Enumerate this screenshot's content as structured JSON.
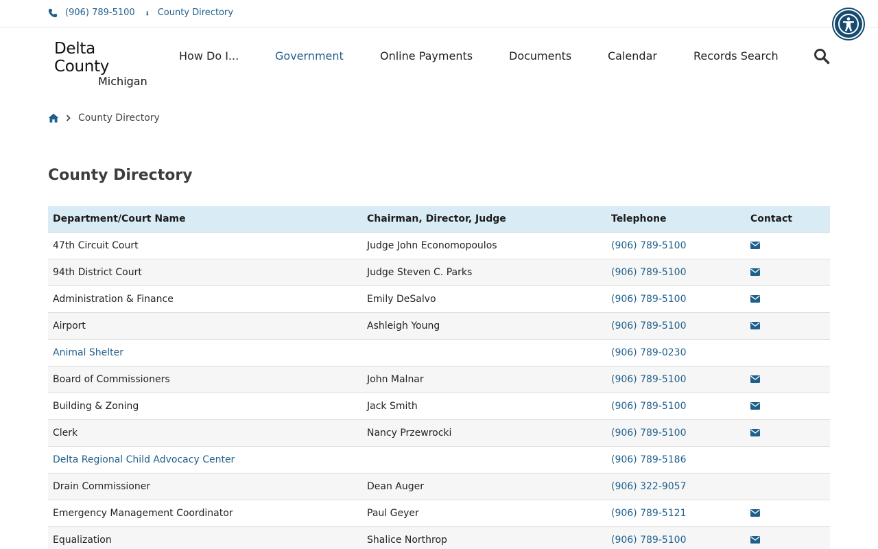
{
  "topbar": {
    "phone": "(906) 789-5100",
    "directory_link": "County Directory"
  },
  "logo": {
    "line1": "Delta County",
    "line2": "Michigan"
  },
  "nav": {
    "items": [
      {
        "label": "How Do I..."
      },
      {
        "label": "Government"
      },
      {
        "label": "Online Payments"
      },
      {
        "label": "Documents"
      },
      {
        "label": "Calendar"
      },
      {
        "label": "Records Search"
      }
    ]
  },
  "breadcrumb": {
    "current": "County Directory"
  },
  "page": {
    "title": "County Directory"
  },
  "table": {
    "headers": [
      "Department/Court Name",
      "Chairman, Director, Judge",
      "Telephone",
      "Contact"
    ],
    "rows": [
      {
        "name": "47th Circuit Court",
        "contact_person": "Judge John Economopoulos",
        "phone": "(906) 789-5100"
      },
      {
        "name": "94th District Court",
        "contact_person": "Judge Steven C. Parks",
        "phone": "(906) 789-5100"
      },
      {
        "name": "Administration & Finance",
        "contact_person": "Emily DeSalvo",
        "phone": "(906) 789-5100"
      },
      {
        "name": "Airport",
        "contact_person": "Ashleigh Young",
        "phone": "(906) 789-5100"
      },
      {
        "name": "Animal Shelter",
        "contact_person": "",
        "phone": "(906) 789-0230"
      },
      {
        "name": "Board of Commissioners",
        "contact_person": "John Malnar",
        "phone": "(906) 789-5100"
      },
      {
        "name": "Building & Zoning",
        "contact_person": "Jack Smith",
        "phone": "(906) 789-5100"
      },
      {
        "name": "Clerk",
        "contact_person": "Nancy Przewrocki",
        "phone": "(906) 789-5100"
      },
      {
        "name": "Delta Regional Child Advocacy Center",
        "contact_person": "",
        "phone": "(906) 789-5186"
      },
      {
        "name": "Drain Commissioner",
        "contact_person": "Dean Auger",
        "phone": "(906) 322-9057"
      },
      {
        "name": "Emergency Management Coordinator",
        "contact_person": "Paul Geyer",
        "phone": "(906) 789-5121"
      },
      {
        "name": "Equalization",
        "contact_person": "Shalice Northrop",
        "phone": "(906) 789-5100"
      }
    ]
  },
  "colors": {
    "accent": "#1f5f8b",
    "header_bg": "#d9ecf5",
    "a11y": "#174a6e"
  },
  "icons": [
    "phone-icon",
    "info-icon",
    "accessibility-icon",
    "search-icon",
    "home-icon",
    "chevron-right-icon",
    "mail-icon"
  ]
}
